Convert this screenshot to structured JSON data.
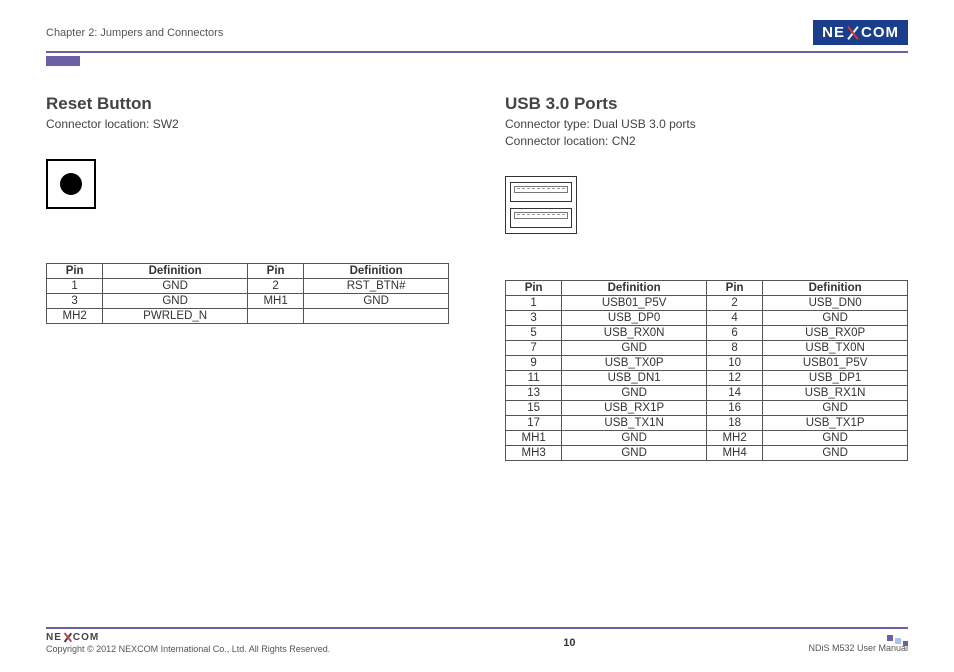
{
  "header": {
    "chapter": "Chapter 2: Jumpers and Connectors",
    "brand": "NEXCOM"
  },
  "left": {
    "title": "Reset Button",
    "subtitle": "Connector location: SW2",
    "table": {
      "headers": [
        "Pin",
        "Definition",
        "Pin",
        "Definition"
      ],
      "rows": [
        [
          "1",
          "GND",
          "2",
          "RST_BTN#"
        ],
        [
          "3",
          "GND",
          "MH1",
          "GND"
        ],
        [
          "MH2",
          "PWRLED_N",
          "",
          ""
        ]
      ]
    }
  },
  "right": {
    "title": "USB 3.0 Ports",
    "sub1": "Connector type: Dual USB 3.0 ports",
    "sub2": "Connector location: CN2",
    "table": {
      "headers": [
        "Pin",
        "Definition",
        "Pin",
        "Definition"
      ],
      "rows": [
        [
          "1",
          "USB01_P5V",
          "2",
          "USB_DN0"
        ],
        [
          "3",
          "USB_DP0",
          "4",
          "GND"
        ],
        [
          "5",
          "USB_RX0N",
          "6",
          "USB_RX0P"
        ],
        [
          "7",
          "GND",
          "8",
          "USB_TX0N"
        ],
        [
          "9",
          "USB_TX0P",
          "10",
          "USB01_P5V"
        ],
        [
          "11",
          "USB_DN1",
          "12",
          "USB_DP1"
        ],
        [
          "13",
          "GND",
          "14",
          "USB_RX1N"
        ],
        [
          "15",
          "USB_RX1P",
          "16",
          "GND"
        ],
        [
          "17",
          "USB_TX1N",
          "18",
          "USB_TX1P"
        ],
        [
          "MH1",
          "GND",
          "MH2",
          "GND"
        ],
        [
          "MH3",
          "GND",
          "MH4",
          "GND"
        ]
      ]
    }
  },
  "footer": {
    "brand": "NEXCOM",
    "copyright": "Copyright © 2012 NEXCOM International Co., Ltd. All Rights Reserved.",
    "page": "10",
    "doc": "NDiS M532 User Manual"
  }
}
